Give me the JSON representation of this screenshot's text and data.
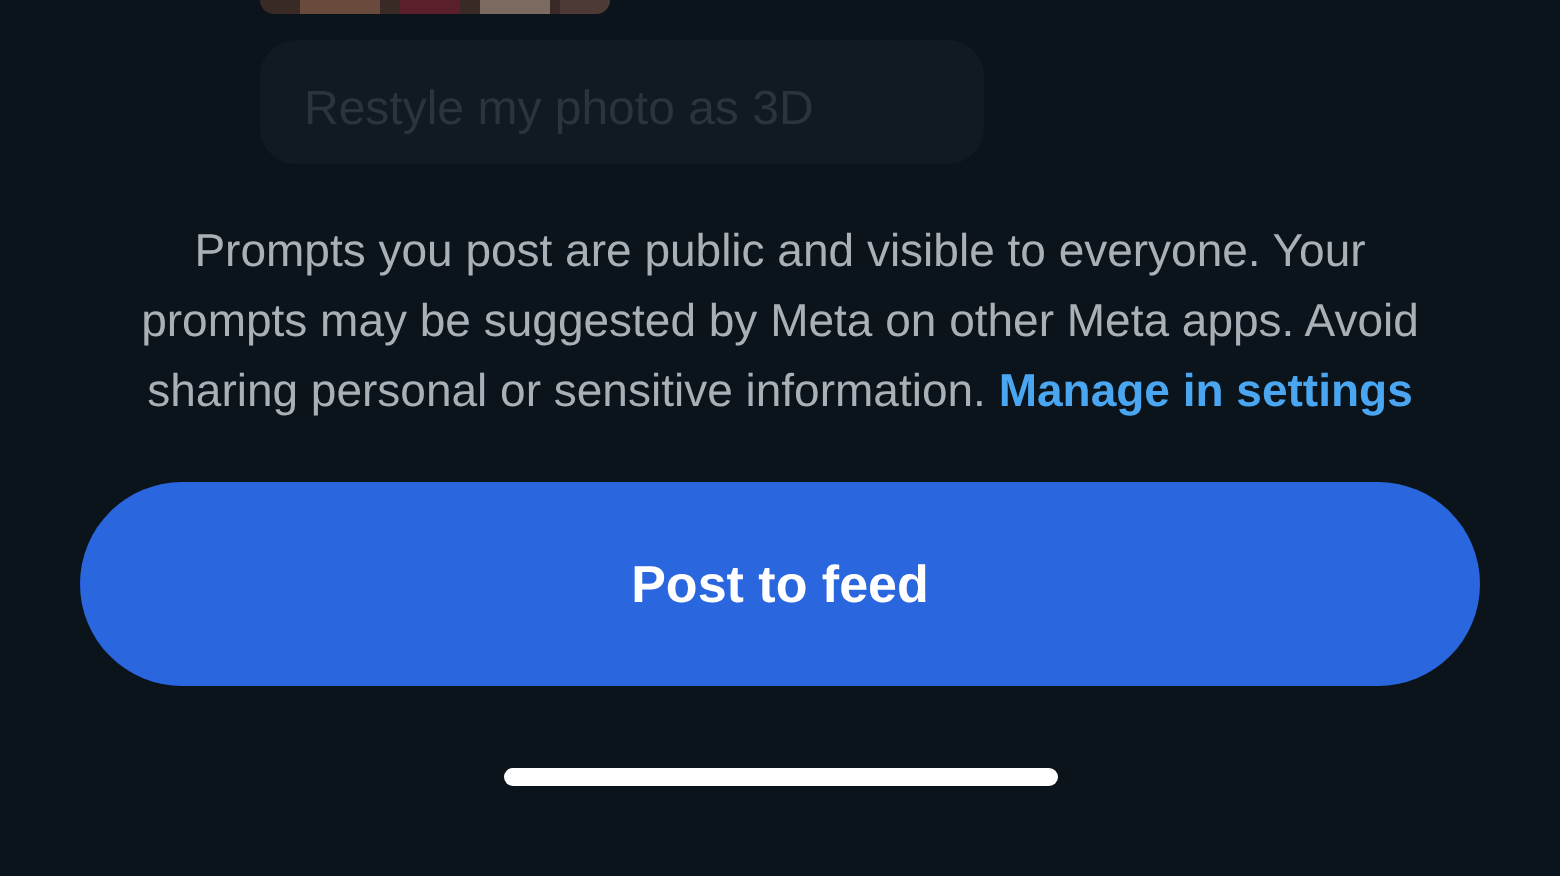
{
  "prompt_bubble": {
    "text": "Restyle my photo as 3D"
  },
  "notice": {
    "text": "Prompts you post are public and visible to everyone. Your prompts may be suggested by Meta on other Meta apps. Avoid sharing personal or sensitive information.",
    "link": "Manage in settings"
  },
  "primary_button": {
    "label": "Post to feed"
  }
}
